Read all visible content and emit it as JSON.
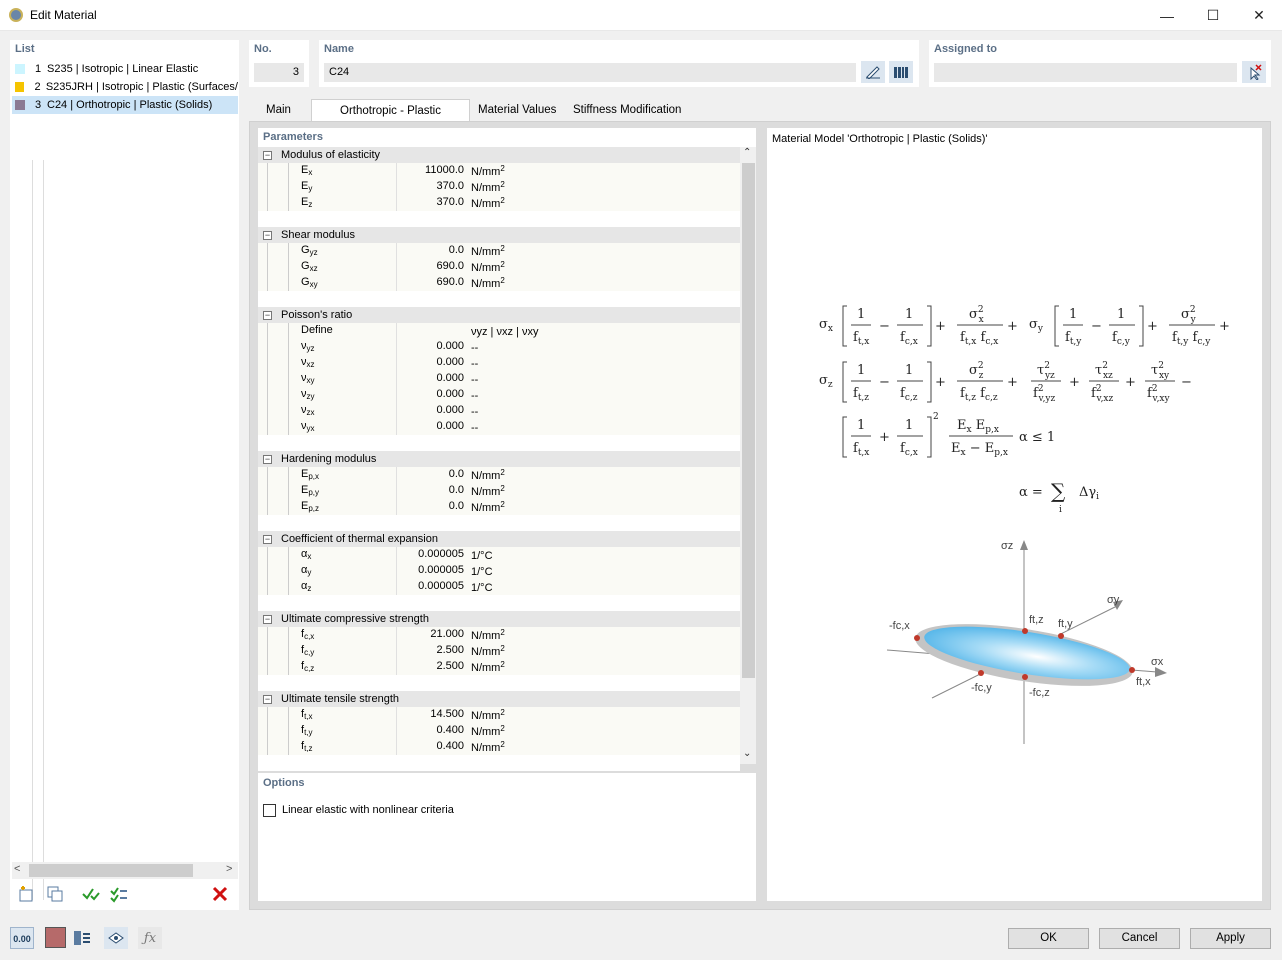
{
  "window": {
    "title": "Edit Material",
    "minimize": "—",
    "maximize": "☐",
    "close": "✕"
  },
  "list": {
    "header": "List",
    "items": [
      {
        "num": "1",
        "label": "S235 | Isotropic | Linear Elastic",
        "color": "#ccf5ff"
      },
      {
        "num": "2",
        "label": "S235JRH | Isotropic | Plastic (Surfaces/",
        "color": "#f5c400"
      },
      {
        "num": "3",
        "label": "C24 | Orthotropic | Plastic (Solids)",
        "color": "#8b7a94"
      }
    ]
  },
  "no": {
    "label": "No.",
    "value": "3"
  },
  "name": {
    "label": "Name",
    "value": "C24"
  },
  "assigned": {
    "label": "Assigned to",
    "value": ""
  },
  "tabs": [
    "Main",
    "Orthotropic - Plastic (Solids)",
    "Material Values",
    "Stiffness Modification"
  ],
  "parameters": {
    "header": "Parameters",
    "groups": [
      {
        "title": "Modulus of elasticity",
        "rows": [
          {
            "sym": "E",
            "sub": "x",
            "value": "11000.0",
            "unit": "N/mm",
            "sup": "2"
          },
          {
            "sym": "E",
            "sub": "y",
            "value": "370.0",
            "unit": "N/mm",
            "sup": "2"
          },
          {
            "sym": "E",
            "sub": "z",
            "value": "370.0",
            "unit": "N/mm",
            "sup": "2"
          }
        ]
      },
      {
        "title": "Shear modulus",
        "rows": [
          {
            "sym": "G",
            "sub": "yz",
            "value": "0.0",
            "unit": "N/mm",
            "sup": "2"
          },
          {
            "sym": "G",
            "sub": "xz",
            "value": "690.0",
            "unit": "N/mm",
            "sup": "2"
          },
          {
            "sym": "G",
            "sub": "xy",
            "value": "690.0",
            "unit": "N/mm",
            "sup": "2"
          }
        ]
      },
      {
        "title": "Poisson's ratio",
        "rows": [
          {
            "sym": "Define",
            "sub": "",
            "value": "",
            "unit": "νyz | νxz | νxy",
            "sup": ""
          },
          {
            "sym": "ν",
            "sub": "yz",
            "value": "0.000",
            "unit": "--",
            "sup": ""
          },
          {
            "sym": "ν",
            "sub": "xz",
            "value": "0.000",
            "unit": "--",
            "sup": ""
          },
          {
            "sym": "ν",
            "sub": "xy",
            "value": "0.000",
            "unit": "--",
            "sup": ""
          },
          {
            "sym": "ν",
            "sub": "zy",
            "value": "0.000",
            "unit": "--",
            "sup": ""
          },
          {
            "sym": "ν",
            "sub": "zx",
            "value": "0.000",
            "unit": "--",
            "sup": ""
          },
          {
            "sym": "ν",
            "sub": "yx",
            "value": "0.000",
            "unit": "--",
            "sup": ""
          }
        ]
      },
      {
        "title": "Hardening modulus",
        "rows": [
          {
            "sym": "E",
            "sub": "p,x",
            "value": "0.0",
            "unit": "N/mm",
            "sup": "2"
          },
          {
            "sym": "E",
            "sub": "p,y",
            "value": "0.0",
            "unit": "N/mm",
            "sup": "2"
          },
          {
            "sym": "E",
            "sub": "p,z",
            "value": "0.0",
            "unit": "N/mm",
            "sup": "2"
          }
        ]
      },
      {
        "title": "Coefficient of thermal expansion",
        "rows": [
          {
            "sym": "α",
            "sub": "x",
            "value": "0.000005",
            "unit": "1/°C",
            "sup": ""
          },
          {
            "sym": "α",
            "sub": "y",
            "value": "0.000005",
            "unit": "1/°C",
            "sup": ""
          },
          {
            "sym": "α",
            "sub": "z",
            "value": "0.000005",
            "unit": "1/°C",
            "sup": ""
          }
        ]
      },
      {
        "title": "Ultimate compressive strength",
        "rows": [
          {
            "sym": "f",
            "sub": "c,x",
            "value": "21.000",
            "unit": "N/mm",
            "sup": "2"
          },
          {
            "sym": "f",
            "sub": "c,y",
            "value": "2.500",
            "unit": "N/mm",
            "sup": "2"
          },
          {
            "sym": "f",
            "sub": "c,z",
            "value": "2.500",
            "unit": "N/mm",
            "sup": "2"
          }
        ]
      },
      {
        "title": "Ultimate tensile strength",
        "rows": [
          {
            "sym": "f",
            "sub": "t,x",
            "value": "14.500",
            "unit": "N/mm",
            "sup": "2"
          },
          {
            "sym": "f",
            "sub": "t,y",
            "value": "0.400",
            "unit": "N/mm",
            "sup": "2"
          },
          {
            "sym": "f",
            "sub": "t,z",
            "value": "0.400",
            "unit": "N/mm",
            "sup": "2"
          }
        ]
      }
    ]
  },
  "options": {
    "header": "Options",
    "checkbox_label": "Linear elastic with nonlinear criteria",
    "checked": false
  },
  "model": {
    "title": "Material Model 'Orthotropic | Plastic (Solids)'"
  },
  "diagram": {
    "sz": "σz",
    "sy": "σy",
    "sx": "σx",
    "ftz": "ft,z",
    "fty": "ft,y",
    "ftx": "ft,x",
    "fcx": "-fc,x",
    "fcy": "-fc,y",
    "fcz": "-fc,z"
  },
  "buttons": {
    "ok": "OK",
    "cancel": "Cancel",
    "apply": "Apply"
  },
  "bottom": {
    "units": "0.00"
  }
}
